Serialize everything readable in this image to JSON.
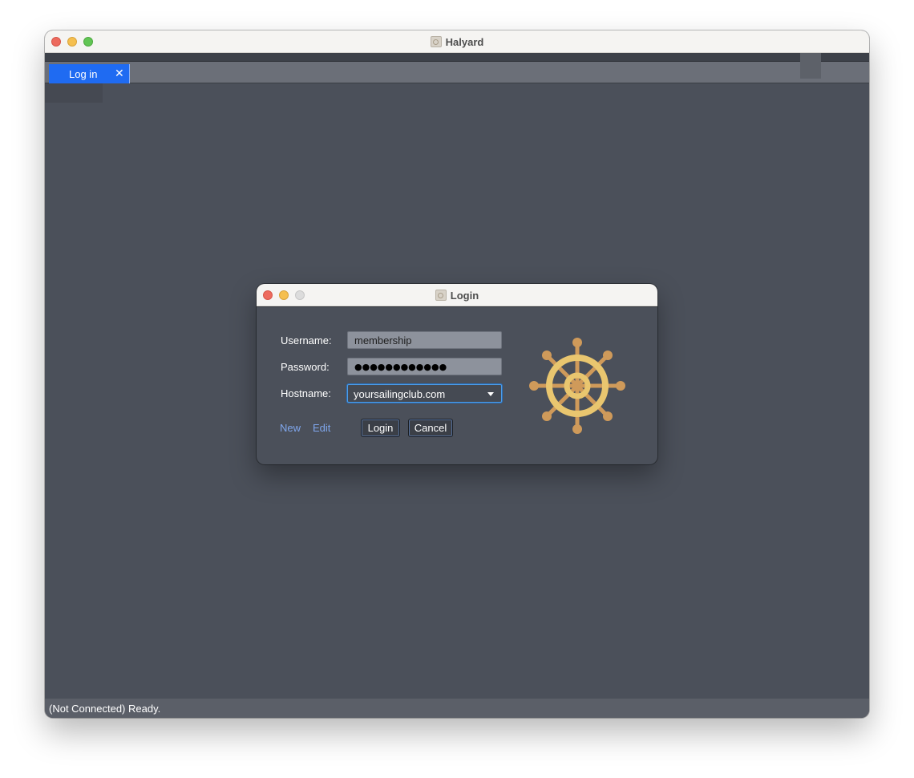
{
  "main_window": {
    "title": "Halyard",
    "app_icon": "helm-app-icon",
    "tabs": [
      {
        "label": "Log in",
        "close_glyph": "✕",
        "active": true
      }
    ],
    "status_text": "(Not Connected) Ready."
  },
  "login_dialog": {
    "title": "Login",
    "username_label": "Username:",
    "username_value": "membership",
    "password_label": "Password:",
    "password_masked": "●●●●●●●●●●●●",
    "hostname_label": "Hostname:",
    "hostname_value": "yoursailingclub.com",
    "new_link": "New",
    "edit_link": "Edit",
    "login_button": "Login",
    "cancel_button": "Cancel",
    "logo_icon": "ship-wheel-icon"
  },
  "colors": {
    "accent_tab": "#1f6bf2",
    "link": "#7fa6ec",
    "wheel_gold": "#e9c66f",
    "wheel_wood": "#cf9a5a",
    "background": "#4b505a"
  }
}
